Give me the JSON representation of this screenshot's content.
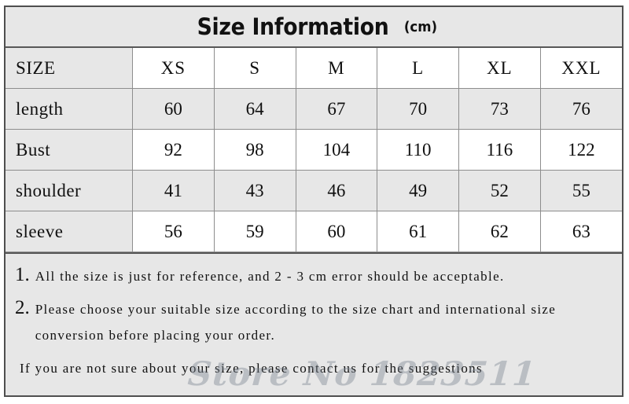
{
  "title": {
    "main": "Size Information",
    "unit": "(cm)"
  },
  "table": {
    "corner_label": "SIZE",
    "size_columns": [
      "XS",
      "S",
      "M",
      "L",
      "XL",
      "XXL"
    ],
    "rows": [
      {
        "label": "length",
        "values": [
          "60",
          "64",
          "67",
          "70",
          "73",
          "76"
        ]
      },
      {
        "label": "Bust",
        "values": [
          "92",
          "98",
          "104",
          "110",
          "116",
          "122"
        ]
      },
      {
        "label": "shoulder",
        "values": [
          "41",
          "43",
          "46",
          "49",
          "52",
          "55"
        ]
      },
      {
        "label": "sleeve",
        "values": [
          "56",
          "59",
          "60",
          "61",
          "62",
          "63"
        ]
      }
    ]
  },
  "notes": {
    "note1_num": "1.",
    "note1_text": "All the size is just for reference, and 2 - 3 cm error should be acceptable.",
    "note2_num": "2.",
    "note2_text": "Please choose your suitable size according to the size chart and international size conversion before placing your order.",
    "note3_text": "If you are not sure about your size, please contact us for the suggestions"
  },
  "watermark": "Store No 1823511",
  "colors": {
    "cell_gray": "#e7e7e7",
    "cell_white": "#ffffff",
    "outer_border": "#4f4f4f",
    "grid_border": "#8d8d8d",
    "text": "#101010"
  }
}
